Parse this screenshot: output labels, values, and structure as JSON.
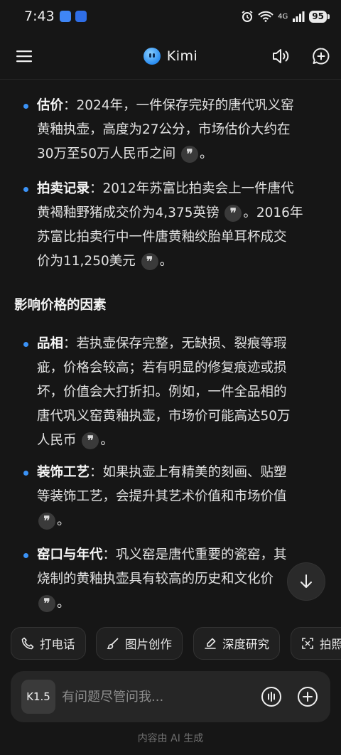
{
  "status": {
    "time": "7:43",
    "battery": "95",
    "network": "4G"
  },
  "header": {
    "title": "Kimi"
  },
  "items": [
    {
      "key": "估价",
      "line1": "：2024年，一件保存完好的唐代巩义窑",
      "line2": "黄釉执壶，高度为27公分，市场估价大约在",
      "line3": "30万至50万人民币之间",
      "after": "。"
    },
    {
      "key": "拍卖记录",
      "line1": "：2012年苏富比拍卖会上一件唐代",
      "line2": "黄褐釉野猪成交价为4,375英镑",
      "mid": "。2016年",
      "line3": "苏富比拍卖行中一件唐黄釉绞胎单耳杯成交",
      "line4": "价为11,250美元",
      "after": "。"
    },
    {
      "key": "品相",
      "line1": "：若执壶保存完整，无缺损、裂痕等瑕",
      "line2": "疵，价格会较高；若有明显的修复痕迹或损",
      "line3": "坏，价值会大打折扣。例如，一件全品相的",
      "line4": "唐代巩义窑黄釉执壶，市场价可能高达50万",
      "line5": "人民币",
      "after": "。"
    },
    {
      "key": "装饰工艺",
      "line1": "：如果执壶上有精美的刻画、贴塑",
      "line2": "等装饰工艺，会提升其艺术价值和市场价值",
      "after": "。"
    },
    {
      "key": "窑口与年代",
      "line1": "：巩义窑是唐代重要的瓷窑，其",
      "line2": "烧制的黄釉执壶具有较高的历史和文化价",
      "after": "。"
    }
  ],
  "section_title": "影响价格的因素",
  "cite_glyph": "❞",
  "chips": [
    {
      "label": "打电话",
      "icon": "phone-icon"
    },
    {
      "label": "图片创作",
      "icon": "brush-icon"
    },
    {
      "label": "深度研究",
      "icon": "research-icon"
    },
    {
      "label": "拍照",
      "icon": "scan-icon"
    }
  ],
  "composer": {
    "model": "K1.5",
    "placeholder": "有问题尽管问我..."
  },
  "footer": "内容由 AI 生成",
  "colors": {
    "accent": "#3b93f7",
    "background": "#161616"
  }
}
